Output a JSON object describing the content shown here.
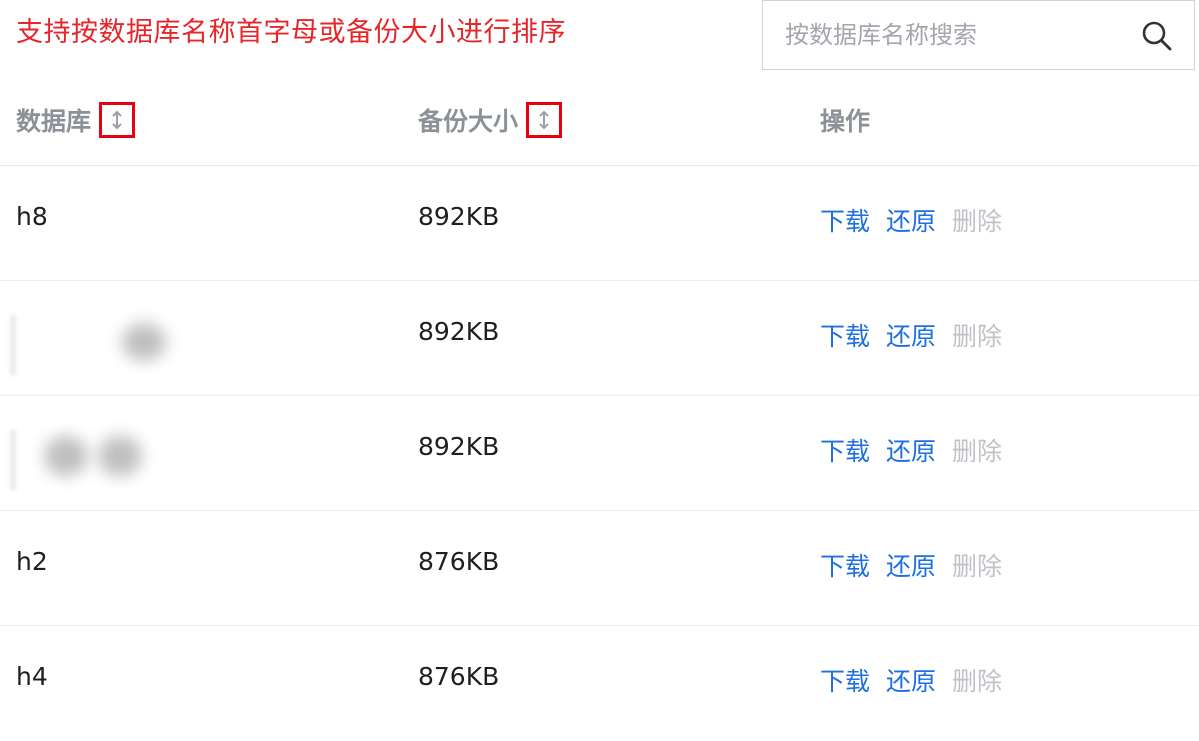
{
  "hint": "支持按数据库名称首字母或备份大小进行排序",
  "search": {
    "placeholder": "按数据库名称搜索"
  },
  "columns": {
    "database": "数据库",
    "size": "备份大小",
    "operations": "操作"
  },
  "actions": {
    "download": "下载",
    "restore": "还原",
    "delete": "删除"
  },
  "rows": [
    {
      "name": "h8",
      "size": "892KB",
      "name_obscured": false
    },
    {
      "name": "",
      "size": "892KB",
      "name_obscured": true
    },
    {
      "name": "",
      "size": "892KB",
      "name_obscured": true
    },
    {
      "name": "h2",
      "size": "876KB",
      "name_obscured": false
    },
    {
      "name": "h4",
      "size": "876KB",
      "name_obscured": false
    }
  ],
  "colors": {
    "hint": "#e5272b",
    "link": "#1e6fe0",
    "disabled": "#bfc2c7",
    "sort_highlight": "#e60012"
  },
  "icons": {
    "search": "search-icon",
    "sort": "sort-icon"
  }
}
